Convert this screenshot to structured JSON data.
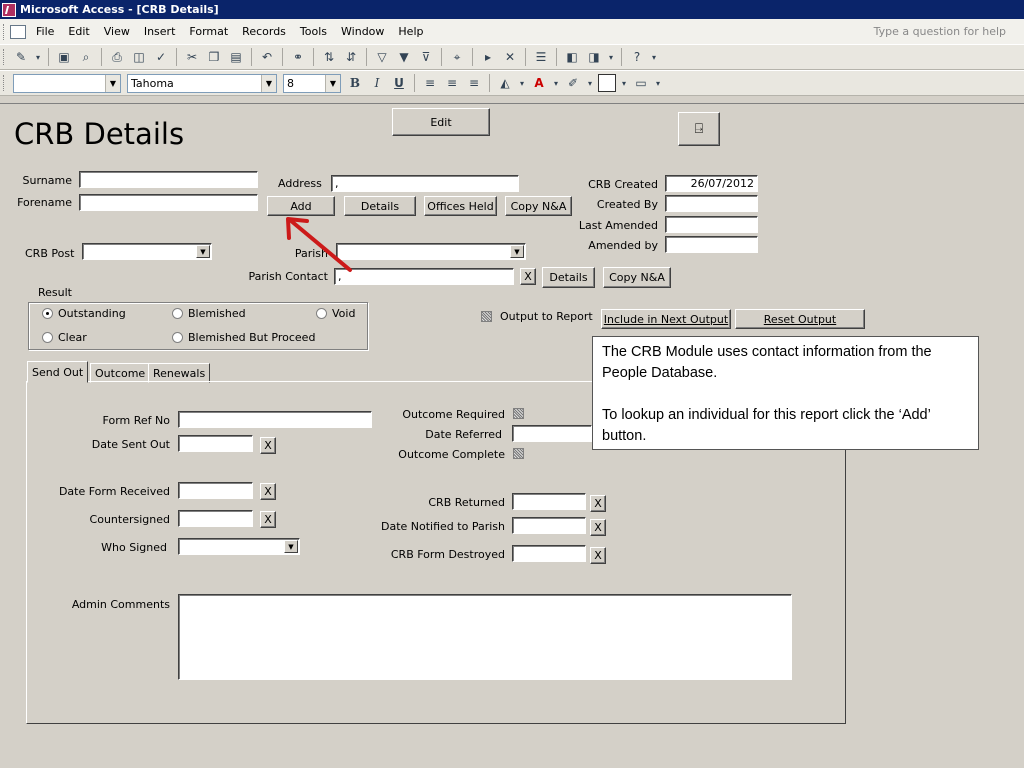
{
  "window": {
    "title": "Microsoft Access - [CRB Details]"
  },
  "menu": {
    "items": [
      "File",
      "Edit",
      "View",
      "Insert",
      "Format",
      "Records",
      "Tools",
      "Window",
      "Help"
    ],
    "help_placeholder": "Type a question for help"
  },
  "format_toolbar": {
    "font": "Tahoma",
    "size": "8",
    "bold": "B",
    "italic": "I",
    "underline": "U"
  },
  "form": {
    "title": "CRB Details",
    "edit_label": "Edit",
    "surname_label": "Surname",
    "forename_label": "Forename",
    "address_label": "Address",
    "address_value": ",",
    "add_label": "Add",
    "details_label": "Details",
    "offices_held_label": "Offices Held",
    "copy_na_label": "Copy N&A",
    "crb_created_label": "CRB Created",
    "crb_created_value": "26/07/2012",
    "created_by_label": "Created By",
    "last_amended_label": "Last Amended",
    "amended_by_label": "Amended by",
    "crb_post_label": "CRB Post",
    "parish_label": "Parish",
    "parish_contact_label": "Parish Contact",
    "parish_contact_value": ",",
    "parish_x": "X",
    "parish_details_label": "Details",
    "parish_copy_label": "Copy N&A",
    "result_label": "Result",
    "result_options": [
      "Outstanding",
      "Blemished",
      "Void",
      "Clear",
      "Blemished But Proceed"
    ],
    "output_to_report_label": "Output to Report",
    "include_next_output_label": "Include in Next Output",
    "reset_output_label": "Reset Output"
  },
  "tabs": [
    "Send Out",
    "Outcome",
    "Renewals"
  ],
  "send_out": {
    "form_ref_label": "Form Ref No",
    "date_sent_label": "Date Sent Out",
    "date_form_received_label": "Date Form Received",
    "countersigned_label": "Countersigned",
    "who_signed_label": "Who Signed",
    "outcome_required_label": "Outcome Required",
    "date_referred_label": "Date Referred",
    "outcome_complete_label": "Outcome Complete",
    "crb_returned_label": "CRB Returned",
    "date_notified_label": "Date Notified to Parish",
    "crb_destroyed_label": "CRB Form Destroyed",
    "admin_comments_label": "Admin Comments",
    "x": "X"
  },
  "callout": {
    "line1": "The CRB Module uses contact information from the People Database.",
    "line2": "To lookup an individual for this report click the ‘Add’ button."
  },
  "colors": {
    "titlebar": "#0a246a",
    "arrow": "#cc1a1a",
    "form_bg": "#d4d0c8"
  }
}
